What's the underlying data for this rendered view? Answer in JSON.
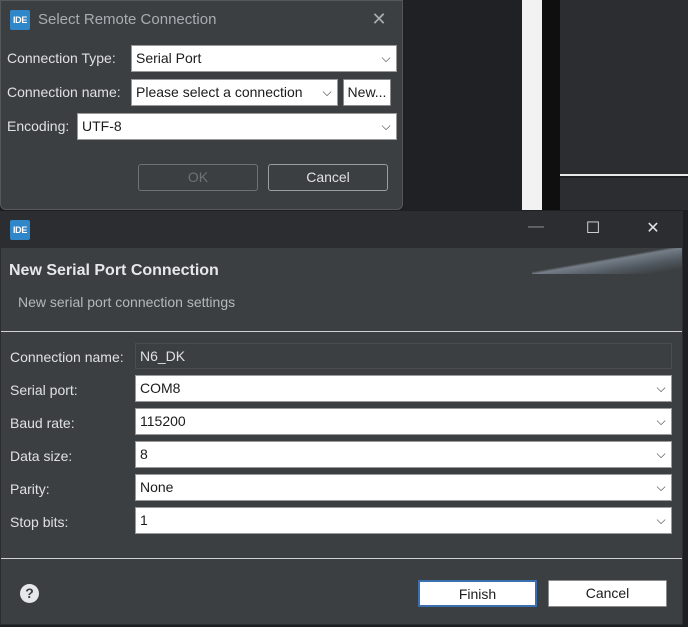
{
  "dialog1": {
    "title": "Select Remote Connection",
    "logo": "IDE",
    "close_glyph": "✕",
    "connection_type_label": "Connection Type:",
    "connection_type_value": "Serial Port",
    "connection_name_label": "Connection name:",
    "connection_name_value": "Please select a connection",
    "new_button": "New...",
    "encoding_label": "Encoding:",
    "encoding_value": "UTF-8",
    "ok_button": "OK",
    "cancel_button": "Cancel"
  },
  "dialog2": {
    "logo": "IDE",
    "minimize_glyph": "—",
    "maximize_glyph": "☐",
    "close_glyph": "✕",
    "title": "New Serial Port Connection",
    "subtitle": "New serial port connection settings",
    "fields": {
      "connection_name_label": "Connection name:",
      "connection_name_value": "N6_DK",
      "serial_port_label": "Serial port:",
      "serial_port_value": "COM8",
      "baud_rate_label": "Baud rate:",
      "baud_rate_value": "115200",
      "data_size_label": "Data size:",
      "data_size_value": "8",
      "parity_label": "Parity:",
      "parity_value": "None",
      "stop_bits_label": "Stop bits:",
      "stop_bits_value": "1"
    },
    "help_glyph": "?",
    "finish_button": "Finish",
    "cancel_button": "Cancel"
  },
  "icons": {
    "dropdown": "chevron-down-icon",
    "help": "help-icon",
    "close": "close-icon"
  },
  "colors": {
    "dialog_bg": "#3c3f41",
    "titlebar_bg": "#2b2d30",
    "logo_bg": "#2f86c9",
    "text": "#dfe1e5"
  }
}
